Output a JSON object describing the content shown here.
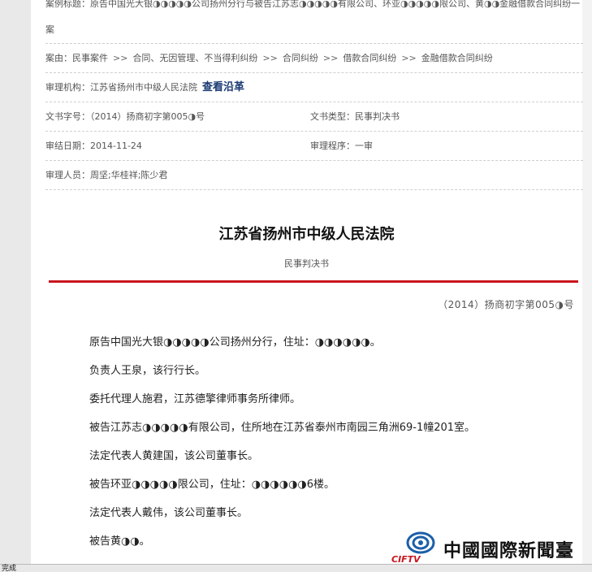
{
  "case_info": {
    "title_label": "案例标题：",
    "title_value": "原告中国光大银◑◑◑◑◑公司扬州分行与被告江苏志◑◑◑◑◑有限公司、环亚◑◑◑◑◑限公司、黄◑◑金融借款合同纠纷一案",
    "cause_label": "案由：",
    "cause_path": [
      "民事案件",
      "合同、无因管理、不当得利纠纷",
      "合同纠纷",
      "借款合同纠纷",
      "金融借款合同纠纷"
    ],
    "cause_separator": ">>",
    "court_label": "审理机构：",
    "court_value": "江苏省扬州市中级人民法院",
    "history_link": "查看沿革",
    "docno_label": "文书字号：",
    "docno_value": "（2014）扬商初字第005◑号",
    "doctype_label": "文书类型：",
    "doctype_value": "民事判决书",
    "date_label": "审结日期：",
    "date_value": "2014-11-24",
    "procedure_label": "审理程序：",
    "procedure_value": "一审",
    "judges_label": "审理人员：",
    "judges_value": "周坚;华桂祥;陈少君"
  },
  "document": {
    "court_name": "江苏省扬州市中级人民法院",
    "doc_kind": "民事判决书",
    "case_number": "（2014）扬商初字第005◑号",
    "paragraphs": [
      "原告中国光大银◑◑◑◑◑公司扬州分行，住址：◑◑◑◑◑◑。",
      "负责人王泉，该行行长。",
      "委托代理人施君，江苏德擎律师事务所律师。",
      "被告江苏志◑◑◑◑◑有限公司，住所地在江苏省泰州市南园三角洲69-1幢201室。",
      "法定代表人黄建国，该公司董事长。",
      "被告环亚◑◑◑◑◑限公司，住址：◑◑◑◑◑◑6楼。",
      "法定代表人戴伟，该公司董事长。",
      "被告黄◑◑。"
    ]
  },
  "watermark": {
    "name": "中國國際新聞臺",
    "abbr": "CIFTV"
  },
  "status_bar": {
    "text": "完成"
  },
  "colors": {
    "rule_red": "#c9151e",
    "link_navy": "#1a3a73"
  }
}
